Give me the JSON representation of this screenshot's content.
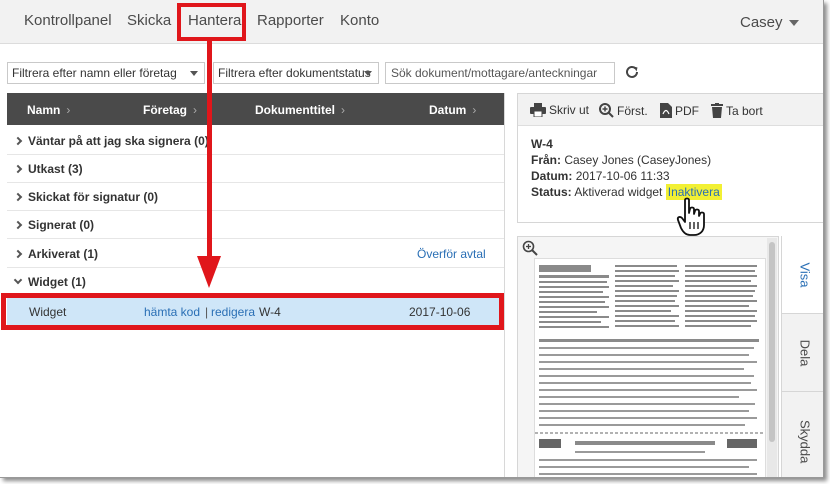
{
  "nav": {
    "items": [
      {
        "label": "Kontrollpanel"
      },
      {
        "label": "Skicka"
      },
      {
        "label": "Hantera"
      },
      {
        "label": "Rapporter"
      },
      {
        "label": "Konto"
      }
    ],
    "user": "Casey"
  },
  "filters": {
    "name_filter": "Filtrera efter namn eller företag",
    "status_filter": "Filtrera efter dokumentstatus",
    "search_placeholder": "Sök dokument/mottagare/anteckningar"
  },
  "table": {
    "columns": [
      "Namn",
      "Företag",
      "Dokumenttitel",
      "Datum"
    ],
    "groups": [
      {
        "label": "Väntar på att jag ska signera (0)",
        "link": ""
      },
      {
        "label": "Utkast (3)",
        "link": ""
      },
      {
        "label": "Skickat för signatur (0)",
        "link": ""
      },
      {
        "label": "Signerat (0)",
        "link": ""
      },
      {
        "label": "Arkiverat (1)",
        "link": "Överför avtal"
      },
      {
        "label": "Widget (1)",
        "link": ""
      }
    ],
    "selected_row": {
      "name": "Widget",
      "link_get_code": "hämta kod",
      "separator": "|",
      "link_edit": "redigera",
      "title": "W-4",
      "date": "2017-10-06"
    }
  },
  "detail": {
    "toolbar": {
      "print": "Skriv ut",
      "zoom": "Först.",
      "pdf": "PDF",
      "delete": "Ta bort"
    },
    "title": "W-4",
    "from_label": "Från:",
    "from_value": "Casey Jones (CaseyJones)",
    "date_label": "Datum:",
    "date_value": "2017-10-06 11:33",
    "status_label": "Status:",
    "status_value": "Aktiverad widget",
    "status_action": "Inaktivera"
  },
  "side_tabs": [
    "Visa",
    "Dela",
    "Skydda"
  ],
  "colors": {
    "highlight_red": "#e0161b",
    "link_blue": "#2a6fb5",
    "selected_row": "#cfe6f8",
    "header_dark": "#4a4a4a"
  }
}
